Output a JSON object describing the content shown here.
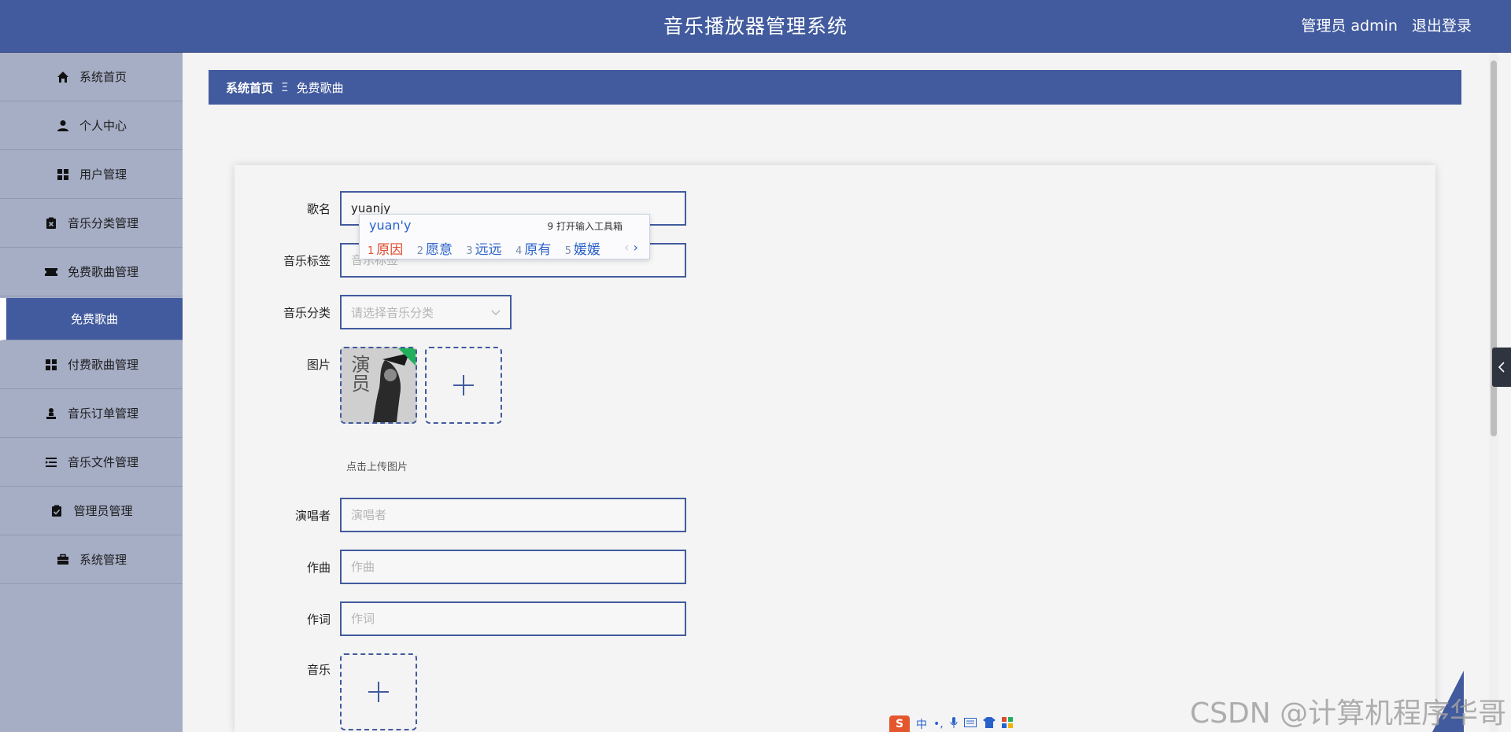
{
  "header": {
    "title": "音乐播放器管理系统",
    "admin_label": "管理员 admin",
    "logout_label": "退出登录"
  },
  "sidebar": {
    "items": [
      {
        "label": "系统首页",
        "icon": "home-icon"
      },
      {
        "label": "个人中心",
        "icon": "user-icon"
      },
      {
        "label": "用户管理",
        "icon": "grid-icon"
      },
      {
        "label": "音乐分类管理",
        "icon": "clipboard-x-icon"
      },
      {
        "label": "免费歌曲管理",
        "icon": "ticket-icon"
      },
      {
        "label": "免费歌曲",
        "icon": "",
        "active": true
      },
      {
        "label": "付费歌曲管理",
        "icon": "grid-icon"
      },
      {
        "label": "音乐订单管理",
        "icon": "person-stamp-icon"
      },
      {
        "label": "音乐文件管理",
        "icon": "list-indent-icon"
      },
      {
        "label": "管理员管理",
        "icon": "clipboard-check-icon"
      },
      {
        "label": "系统管理",
        "icon": "briefcase-icon"
      }
    ]
  },
  "breadcrumb": {
    "home": "系统首页",
    "separator": "Ξ",
    "current": "免费歌曲"
  },
  "form": {
    "song_name": {
      "label": "歌名",
      "value": "yuanjy"
    },
    "music_tag": {
      "label": "音乐标签",
      "placeholder": "音乐标签"
    },
    "category": {
      "label": "音乐分类",
      "placeholder": "请选择音乐分类"
    },
    "image": {
      "label": "图片",
      "hint": "点击上传图片",
      "thumb_text": "演员"
    },
    "singer": {
      "label": "演唱者",
      "placeholder": "演唱者"
    },
    "composer": {
      "label": "作曲",
      "placeholder": "作曲"
    },
    "lyricist": {
      "label": "作词",
      "placeholder": "作词"
    },
    "music": {
      "label": "音乐"
    }
  },
  "ime": {
    "pinyin": "yuan'y",
    "tool_hint": "9 打开输入工具箱",
    "candidates": [
      {
        "n": "1",
        "text": "原因"
      },
      {
        "n": "2",
        "text": "愿意"
      },
      {
        "n": "3",
        "text": "远远"
      },
      {
        "n": "4",
        "text": "原有"
      },
      {
        "n": "5",
        "text": "媛媛"
      }
    ],
    "status_lang": "中"
  },
  "watermark": "CSDN @计算机程序华哥",
  "colors": {
    "primary": "#425b9e",
    "sidebar": "#a6aec6",
    "background": "#f4f4f5"
  }
}
